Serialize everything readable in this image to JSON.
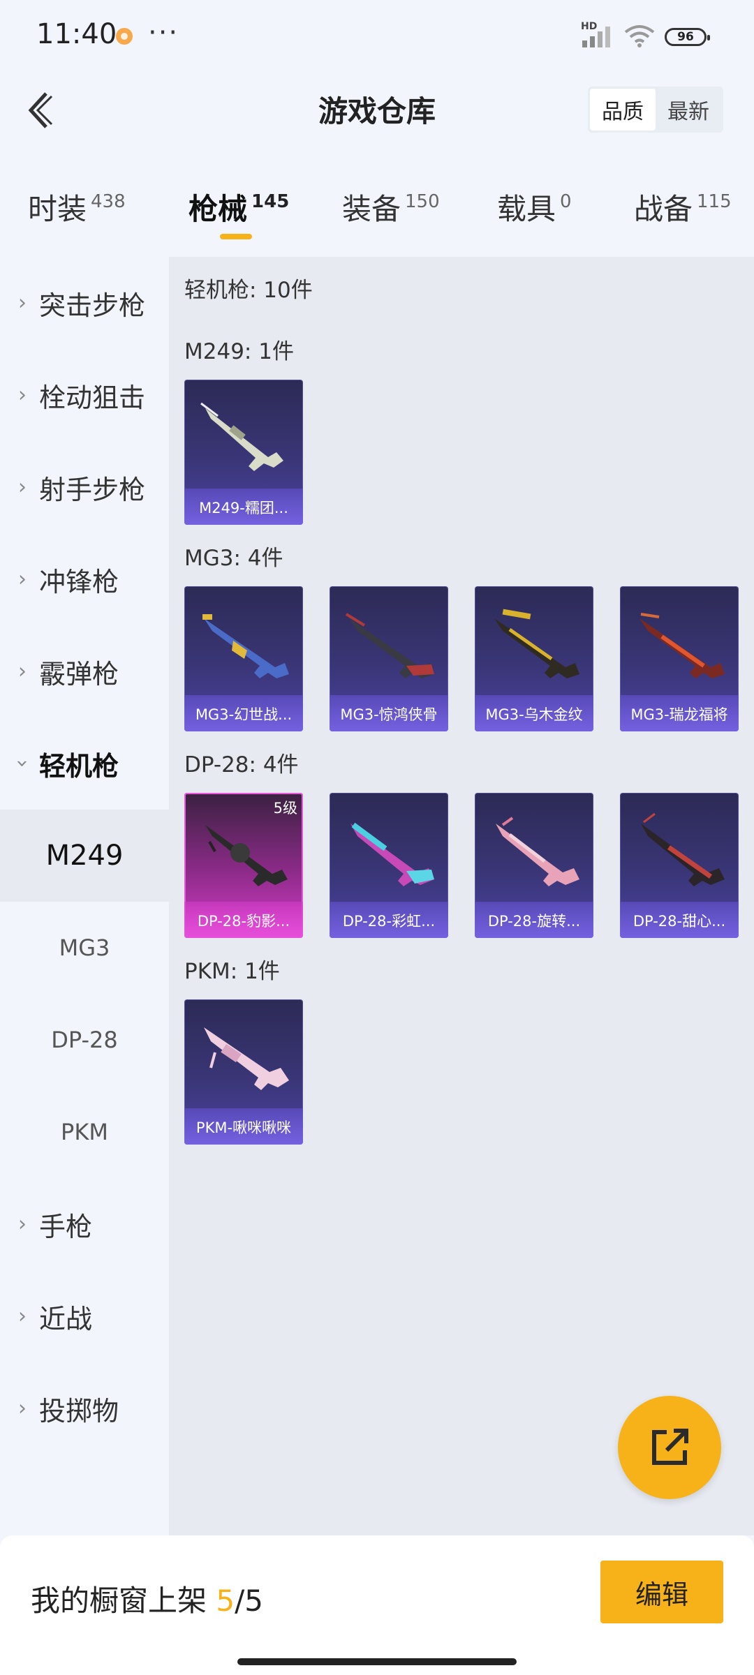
{
  "status": {
    "time": "11:40",
    "more": "···",
    "hd": "HD",
    "battery": "96"
  },
  "header": {
    "title": "游戏仓库",
    "sort_options": [
      "品质",
      "最新"
    ]
  },
  "tabs": [
    {
      "label": "时装",
      "count": "438"
    },
    {
      "label": "枪械",
      "count": "145"
    },
    {
      "label": "装备",
      "count": "150"
    },
    {
      "label": "载具",
      "count": "0"
    },
    {
      "label": "战备",
      "count": "115"
    }
  ],
  "sidebar": {
    "categories": [
      "突击步枪",
      "栓动狙击",
      "射手步枪",
      "冲锋枪",
      "霰弹枪",
      "轻机枪",
      "手枪",
      "近战",
      "投掷物"
    ],
    "subitems": [
      "M249",
      "MG3",
      "DP-28",
      "PKM"
    ]
  },
  "content": {
    "category_title": "轻机枪: 10件",
    "groups": [
      {
        "title": "M249: 1件",
        "items": [
          {
            "name": "M249-糯团...",
            "level": ""
          }
        ]
      },
      {
        "title": "MG3: 4件",
        "items": [
          {
            "name": "MG3-幻世战...",
            "level": ""
          },
          {
            "name": "MG3-惊鸿侠骨",
            "level": ""
          },
          {
            "name": "MG3-乌木金纹",
            "level": ""
          },
          {
            "name": "MG3-瑞龙福将",
            "level": ""
          }
        ]
      },
      {
        "title": "DP-28: 4件",
        "items": [
          {
            "name": "DP-28-豹影...",
            "level": "5级"
          },
          {
            "name": "DP-28-彩虹...",
            "level": ""
          },
          {
            "name": "DP-28-旋转...",
            "level": ""
          },
          {
            "name": "DP-28-甜心...",
            "level": ""
          }
        ]
      },
      {
        "title": "PKM: 1件",
        "items": [
          {
            "name": "PKM-啾咪啾咪",
            "level": ""
          }
        ]
      }
    ]
  },
  "bottom": {
    "showcase_label": "我的橱窗上架",
    "showcase_current": "5",
    "showcase_sep": "/",
    "showcase_total": "5",
    "edit_label": "编辑"
  },
  "colors": {
    "accent": "#f7b21a",
    "background": "#f2f6fc",
    "panel": "#e7ebf1"
  }
}
